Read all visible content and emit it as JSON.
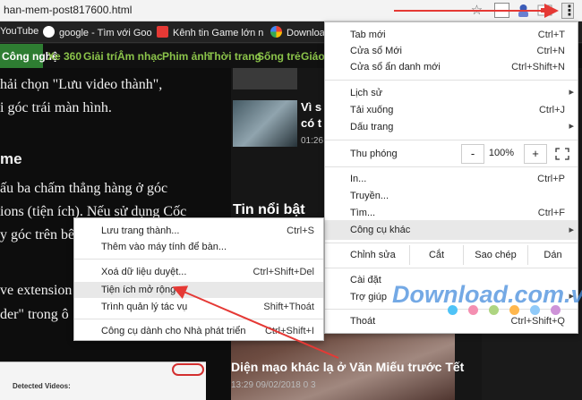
{
  "browser": {
    "url": "han-mem-post817600.html",
    "bookmarks": [
      {
        "label": "YouTube",
        "color": "#ff0000"
      },
      {
        "label": "google - Tìm với Goo",
        "color": "#ffffff"
      },
      {
        "label": "Kênh tin Game lớn n",
        "color": "#e53935"
      },
      {
        "label": "Downloa",
        "color": "#fbbc05"
      }
    ]
  },
  "site_nav": {
    "active": "Công nghệ",
    "items": [
      "Xe 360",
      "Giải trí",
      "Âm nhạc",
      "Phim ảnh",
      "Thời trang",
      "Sống trẻ",
      "Giáo"
    ]
  },
  "article": {
    "lines": [
      "hải chọn \"Lưu video thành\",",
      "i góc trái màn hình."
    ],
    "heading": "me",
    "lines2": [
      "ấu ba chấm thẳng hàng ở góc",
      "ions (tiện ích). Nếu sử dụng Cốc",
      "y góc trên bê"
    ],
    "lines3": [
      "ve extension",
      "der\" trong ô"
    ],
    "screenshot_label": "Detected Videos:"
  },
  "sidebar": {
    "item_title_1": "Vì s",
    "item_title_2": "có t",
    "item_time": "01:26",
    "section_title": "Tin nổi bật",
    "big_title": "Diện mạo khác lạ ở Văn Miếu trước Tết",
    "big_meta": "13:29 09/02/2018   0   3"
  },
  "menu": {
    "new_tab": {
      "label": "Tab mới",
      "shortcut": "Ctrl+T"
    },
    "new_window": {
      "label": "Cửa sổ Mới",
      "shortcut": "Ctrl+N"
    },
    "incognito": {
      "label": "Cửa sổ ẩn danh mới",
      "shortcut": "Ctrl+Shift+N"
    },
    "history": {
      "label": "Lịch sử"
    },
    "downloads": {
      "label": "Tải xuống",
      "shortcut": "Ctrl+J"
    },
    "bookmarks": {
      "label": "Dấu trang"
    },
    "zoom": {
      "label": "Thu phóng",
      "minus": "-",
      "value": "100%",
      "plus": "+"
    },
    "print": {
      "label": "In...",
      "shortcut": "Ctrl+P"
    },
    "cast": {
      "label": "Truyền..."
    },
    "find": {
      "label": "Tìm...",
      "shortcut": "Ctrl+F"
    },
    "more_tools": {
      "label": "Công cụ khác"
    },
    "edit": {
      "label": "Chỉnh sửa",
      "cut": "Cắt",
      "copy": "Sao chép",
      "paste": "Dán"
    },
    "settings": {
      "label": "Cài đặt"
    },
    "help": {
      "label": "Trợ giúp"
    },
    "exit": {
      "label": "Thoát",
      "shortcut": "Ctrl+Shift+Q"
    }
  },
  "submenu": {
    "save_page": {
      "label": "Lưu trang thành...",
      "shortcut": "Ctrl+S"
    },
    "add_to_desktop": {
      "label": "Thêm vào máy tính để bàn..."
    },
    "clear_data": {
      "label": "Xoá dữ liệu duyệt...",
      "shortcut": "Ctrl+Shift+Del"
    },
    "extensions": {
      "label": "Tiện ích mở rộng"
    },
    "task_manager": {
      "label": "Trình quản lý tác vụ",
      "shortcut": "Shift+Thoát"
    },
    "dev_tools": {
      "label": "Công cụ dành cho Nhà phát triển",
      "shortcut": "Ctrl+Shift+I"
    }
  },
  "watermark": {
    "text": "Download.com.vn",
    "dot_colors": [
      "#4fc3f7",
      "#f48fb1",
      "#aed581",
      "#ffb74d",
      "#90caf9",
      "#ce93d8"
    ]
  },
  "annotation_color": "#e53935"
}
